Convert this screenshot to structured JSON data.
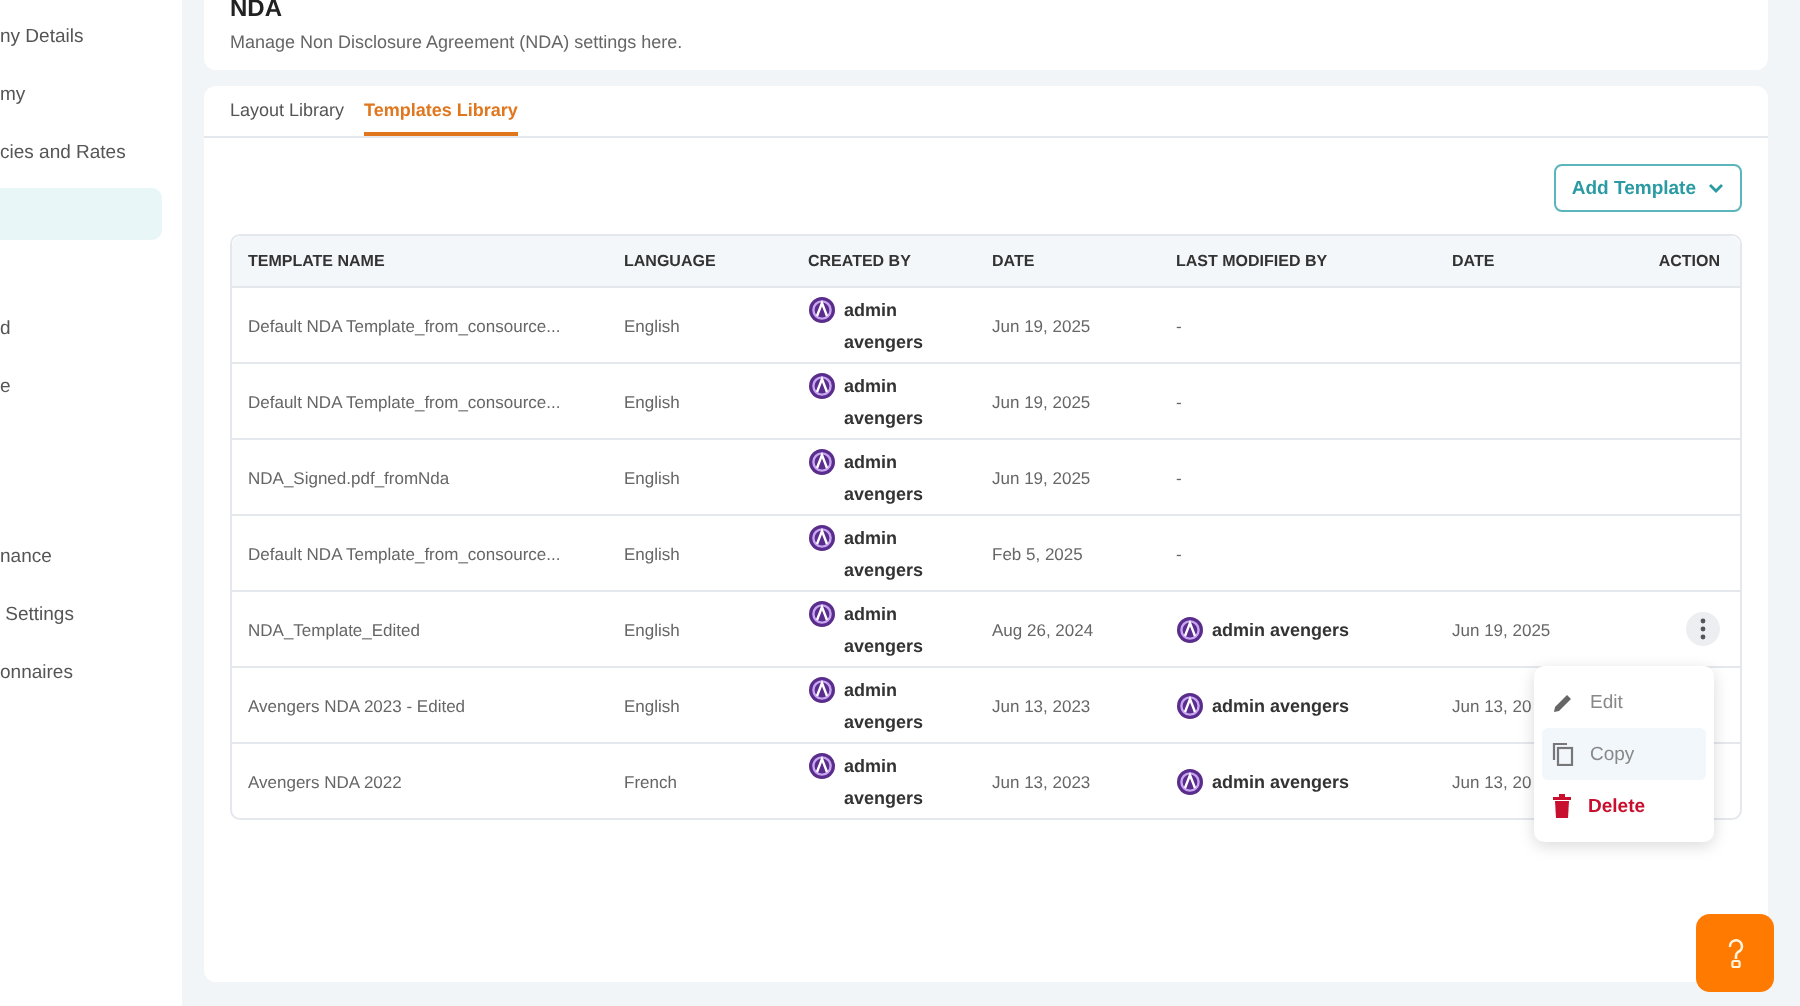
{
  "sidebar": {
    "groups": [
      [
        {
          "label": "ny Details",
          "selected": false
        },
        {
          "label": "my",
          "selected": false
        },
        {
          "label": "cies and Rates",
          "selected": false
        },
        {
          "selected": true
        },
        {
          "label": "d",
          "selected": false
        },
        {
          "label": "e",
          "selected": false
        }
      ],
      [
        {
          "label": "nance",
          "selected": false
        },
        {
          "label": " Settings",
          "selected": false
        },
        {
          "label": "onnaires",
          "selected": false
        }
      ]
    ]
  },
  "header": {
    "title": "NDA",
    "subtitle": "Manage Non Disclosure Agreement (NDA) settings here."
  },
  "tabs": [
    {
      "label": "Layout Library",
      "selected": false
    },
    {
      "label": "Templates Library",
      "selected": true
    }
  ],
  "add_button": {
    "label": "Add Template"
  },
  "table": {
    "columns": [
      "TEMPLATE NAME",
      "LANGUAGE",
      "CREATED BY",
      "DATE",
      "LAST MODIFIED BY",
      "DATE",
      "ACTION"
    ],
    "rows": [
      {
        "name": "Default NDA Template_from_consource...",
        "language": "English",
        "created_by": [
          "admin",
          "avengers"
        ],
        "date": "Jun 19, 2025",
        "modified_by": "-"
      },
      {
        "name": "Default NDA Template_from_consource...",
        "language": "English",
        "created_by": [
          "admin",
          "avengers"
        ],
        "date": "Jun 19, 2025",
        "modified_by": "-"
      },
      {
        "name": "NDA_Signed.pdf_fromNda",
        "language": "English",
        "created_by": [
          "admin",
          "avengers"
        ],
        "date": "Jun 19, 2025",
        "modified_by": "-"
      },
      {
        "name": "Default NDA Template_from_consource...",
        "language": "English",
        "created_by": [
          "admin",
          "avengers"
        ],
        "date": "Feb 5, 2025",
        "modified_by": "-"
      },
      {
        "name": "NDA_Template_Edited",
        "language": "English",
        "created_by": [
          "admin",
          "avengers"
        ],
        "date": "Aug 26, 2024",
        "modifier": "admin avengers",
        "modified_date": "Jun 19, 2025",
        "menu": [
          {
            "kind": "edit",
            "label": "Edit",
            "selected": false
          },
          {
            "kind": "copy",
            "label": "Copy",
            "selected": true
          },
          {
            "kind": "delete",
            "label": "Delete",
            "selected": false
          }
        ]
      },
      {
        "name": "Avengers NDA 2023 - Edited",
        "language": "English",
        "created_by": [
          "admin",
          "avengers"
        ],
        "date": "Jun 13, 2023",
        "modifier": "admin avengers",
        "modified_date": "Jun 13, 20"
      },
      {
        "name": "Avengers NDA 2022",
        "language": "French",
        "created_by": [
          "admin",
          "avengers"
        ],
        "date": "Jun 13, 2023",
        "modifier": "admin avengers",
        "modified_date": "Jun 13, 20"
      }
    ]
  }
}
